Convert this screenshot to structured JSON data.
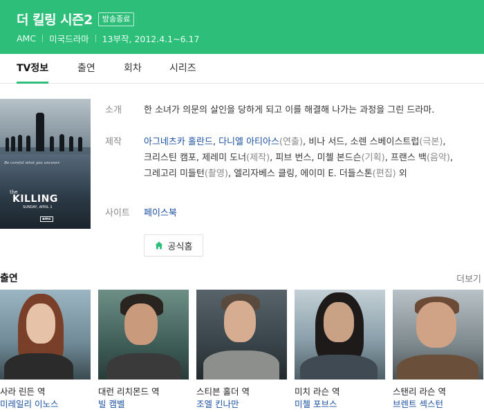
{
  "header": {
    "title": "더 킬링 시즌2",
    "status_badge": "방송종료",
    "channel": "AMC",
    "genre": "미국드라마",
    "episodes_period": "13부작, 2012.4.1~6.17",
    "accent_color": "#2dbe7a"
  },
  "tabs": [
    {
      "label": "TV정보",
      "active": true
    },
    {
      "label": "출연",
      "active": false
    },
    {
      "label": "회차",
      "active": false
    },
    {
      "label": "시리즈",
      "active": false
    }
  ],
  "poster": {
    "tagline": "Be careful what you uncover.",
    "logo_the": "the",
    "logo_name": "KILLING",
    "date_text": "SUNDAY, APRIL 1",
    "network_logo": "amc"
  },
  "info": {
    "intro_label": "소개",
    "intro_text": "한 소녀가 의문의 살인을 당하게 되고 이를 해결해 나가는 과정을 그린 드라마.",
    "production_label": "제작",
    "production": {
      "director_1": "아그네츠카 홀란드",
      "sep_1": ", ",
      "director_2": "다니엘 아티아스",
      "director_role": "(연출)",
      "rest_1": ", 비나 서드, 소렌 스베이스트럽",
      "writer_role": "(극본)",
      "rest_2": ", 크리스틴 캠포, 제레미 도너",
      "producer_role": "(제작)",
      "rest_3": ", 피브 번스, 미첼 본드슨",
      "planning_role": "(기획)",
      "rest_4": ", 프랜스 백",
      "music_role": "(음악)",
      "rest_5": ", 그레고리 미들턴",
      "camera_role": "(촬영)",
      "rest_6": ", 엘리자베스 클링, 에이미 E. 더들스톤",
      "editing_role": "(편집)",
      "rest_7": " 외"
    },
    "site_label": "사이트",
    "site_link": "페이스북",
    "official_button": "공식홈"
  },
  "cast_section": {
    "title": "출연",
    "more": "더보기",
    "members": [
      {
        "role": "사라 린든 역",
        "actor": "미레일리 이노스"
      },
      {
        "role": "대런 리치몬드 역",
        "actor": "빌 캠벨"
      },
      {
        "role": "스티븐 홀더 역",
        "actor": "조엘 킨나만"
      },
      {
        "role": "미치 라슨 역",
        "actor": "미첼 포브스"
      },
      {
        "role": "스탠리 라슨 역",
        "actor": "브렌트 섹스턴"
      }
    ]
  }
}
